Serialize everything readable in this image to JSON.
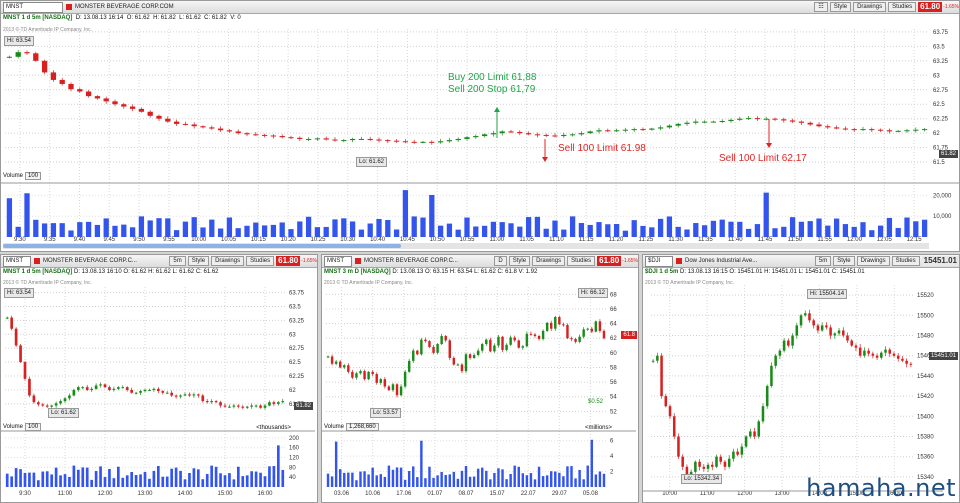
{
  "main": {
    "symbol": "MNST",
    "company": "MONSTER BEVERAGE CORP.COM",
    "style_btn": "Style",
    "drawings_btn": "Drawings",
    "studies_btn": "Studies",
    "price": "61.80",
    "change": "-1.65%",
    "ohlc": {
      "label": "MNST 1 d 5m [NASDAQ]",
      "d": "D: 13.08.13 16:14",
      "o": "O: 61.62",
      "h": "H: 61.82",
      "l": "L: 61.62",
      "c": "C: 61.82",
      "v": "V: 0"
    },
    "copyright": "2013 © TD Ameritrade IP Company, Inc.",
    "hi_label": "Hi: 63.54",
    "lo_label": "Lo: 61.62",
    "current_tag": "61.82",
    "volume_label": "Volume",
    "volume_value": "100",
    "annotations": {
      "buy": "Buy 200 Limit 61,88",
      "sell_stop": "Sell 200 Stop 61,79",
      "sell1": "Sell 100 Limit 61.98",
      "sell2": "Sell 100 Limit 62.17"
    },
    "colors": {
      "up": "#1a8a1a",
      "down": "#d72020",
      "volume": "#3355ee",
      "buy_text": "#1fa648",
      "sell_text": "#e02424"
    }
  },
  "pane2": {
    "symbol": "MNST",
    "company": "MONSTER BEVERAGE CORP.C...",
    "agg": "5m",
    "style_btn": "Style",
    "drawings_btn": "Drawings",
    "studies_btn": "Studies",
    "price": "61.80",
    "change": "-1.65%",
    "ohlc": {
      "label": "MNST 1 d 5m [NASDAQ]",
      "d": "D: 13.08.13 16:10",
      "o": "O: 61.62",
      "h": "H: 61.62",
      "l": "L: 61.62",
      "c": "C: 61.62"
    },
    "copyright": "2013 © TD Ameritrade IP Company, Inc.",
    "hi_label": "Hi: 63.54",
    "lo_label": "Lo: 61.62",
    "current_tag": "61.82",
    "volume_label": "Volume",
    "volume_value": "100",
    "unit": "<thousands>"
  },
  "pane3": {
    "symbol": "MNST",
    "company": "MONSTER BEVERAGE CORP.C...",
    "agg": "D",
    "style_btn": "Style",
    "drawings_btn": "Drawings",
    "studies_btn": "Studies",
    "price": "61.80",
    "change": "-1.65%",
    "ohlc": {
      "label": "MNST 3 m D [NASDAQ]",
      "d": "D: 13.08.13",
      "o": "O: 63.15",
      "h": "H: 63.54",
      "l": "L: 61.62",
      "c": "C: 61.8",
      "v": "V: 1.92"
    },
    "copyright": "2013 © TD Ameritrade IP Company, Inc.",
    "hi_label": "Hi: 66.12",
    "lo_label": "Lo: 53.57",
    "current_tag": "61.8",
    "div_label": "$0.52",
    "volume_label": "Volume",
    "volume_value": "1,268,660",
    "unit": "<millions>"
  },
  "pane4": {
    "symbol": "$DJI",
    "company": "Dow Jones Industrial Ave...",
    "agg": "5m",
    "style_btn": "Style",
    "drawings_btn": "Drawings",
    "studies_btn": "Studies",
    "price": "15451.01",
    "ohlc": {
      "label": "$DJI 1 d 5m",
      "d": "D: 13.08.13 16:15",
      "o": "O: 15451.01",
      "h": "H: 15451.01",
      "l": "L: 15451.01",
      "c": "C: 15451.01"
    },
    "copyright": "2013 © TD Ameritrade IP Company, Inc.",
    "hi_label": "Hi: 15504.14",
    "lo_label": "Lo: 15342.34",
    "current_tag": "15451.01"
  },
  "watermark": "hamaha.net",
  "chart_data": [
    {
      "type": "candlestick",
      "title": "MNST 1 d 5m [NASDAQ]",
      "y_ticks": [
        61.5,
        61.75,
        62,
        62.25,
        62.5,
        62.75,
        63,
        63.25,
        63.5,
        63.75
      ],
      "ylim": [
        61.45,
        63.8
      ],
      "x_ticks": [
        "9:30",
        "9:35",
        "9:40",
        "9:45",
        "9:50",
        "9:55",
        "10:00",
        "10:05",
        "10:15",
        "10:20",
        "10:25",
        "10:30",
        "10:40",
        "10:45",
        "10:50",
        "10:55",
        "11:00",
        "11:05",
        "11:10",
        "11:15",
        "11:20",
        "11:25",
        "11:30",
        "11:35",
        "11:40",
        "11:45",
        "11:50",
        "11:55",
        "12:00",
        "12:05",
        "12:15"
      ],
      "close_series": [
        63.32,
        63.4,
        63.38,
        63.25,
        63.05,
        62.92,
        62.85,
        62.76,
        62.72,
        62.64,
        62.6,
        62.55,
        62.5,
        62.46,
        62.42,
        62.37,
        62.3,
        62.25,
        62.2,
        62.16,
        62.15,
        62.12,
        62.1,
        62.08,
        62.05,
        62.03,
        62.0,
        61.98,
        61.97,
        61.96,
        61.95,
        61.93,
        61.92,
        61.9,
        61.9,
        61.91,
        61.89,
        61.88,
        61.88,
        61.9,
        61.9,
        61.89,
        61.88,
        61.87,
        61.86,
        61.85,
        61.84,
        61.85,
        61.84,
        61.86,
        61.88,
        61.9,
        61.93,
        61.95,
        61.98,
        62.0,
        62.03,
        62.02,
        62.0,
        61.98,
        61.97,
        61.96,
        61.95,
        61.97,
        61.98,
        62.0,
        62.03,
        62.05,
        62.04,
        62.05,
        62.06,
        62.07,
        62.06,
        62.08,
        62.1,
        62.13,
        62.16,
        62.18,
        62.2,
        62.2,
        62.2,
        62.21,
        62.23,
        62.25,
        62.26,
        62.25,
        62.25,
        62.24,
        62.22,
        62.2,
        62.18,
        62.15,
        62.12,
        62.1,
        62.08,
        62.07,
        62.06,
        62.07,
        62.06,
        62.05,
        62.03,
        62.04,
        62.05,
        62.06,
        62.07
      ],
      "volume_ticks": [
        "10,000",
        "20,000"
      ]
    },
    {
      "type": "candlestick",
      "title": "MNST 1 d 5m [NASDAQ]",
      "y_ticks": [
        61.75,
        62,
        62.25,
        62.5,
        62.75,
        63,
        63.25,
        63.5,
        63.75
      ],
      "ylim": [
        61.55,
        63.85
      ],
      "x_ticks": [
        "9:30",
        "11:00",
        "12:00",
        "13:00",
        "14:00",
        "15:00",
        "16:00"
      ],
      "close_series": [
        63.3,
        63.1,
        62.8,
        62.5,
        62.2,
        61.9,
        61.78,
        61.74,
        61.72,
        61.7,
        61.72,
        61.76,
        61.8,
        61.85,
        61.9,
        62.0,
        62.05,
        62.05,
        62.0,
        62.02,
        62.08,
        62.1,
        62.05,
        62.0,
        62.02,
        62.05,
        62.05,
        62.0,
        61.95,
        61.95,
        61.98,
        62.0,
        62.0,
        62.02,
        61.98,
        61.95,
        61.95,
        61.9,
        61.88,
        61.9,
        61.92,
        61.9,
        61.92,
        61.9,
        61.8,
        61.78,
        61.8,
        61.78,
        61.72,
        61.7,
        61.7,
        61.72,
        61.7,
        61.68,
        61.7,
        61.72,
        61.72,
        61.68,
        61.72,
        61.78,
        61.75,
        61.78,
        61.8
      ],
      "volume_ticks": [
        "40",
        "80",
        "120",
        "160",
        "200"
      ]
    },
    {
      "type": "candlestick",
      "title": "MNST 3 m D [NASDAQ]",
      "y_ticks": [
        52,
        54,
        56,
        58,
        60,
        62,
        64,
        66,
        68
      ],
      "ylim": [
        51.5,
        69
      ],
      "x_ticks": [
        "03.06",
        "10.06",
        "17.06",
        "01.07",
        "08.07",
        "15.07",
        "22.07",
        "29.07",
        "05.08"
      ],
      "close_series": [
        59.5,
        58.5,
        58.8,
        58.0,
        58.3,
        57.4,
        56.6,
        57.2,
        57.5,
        56.4,
        57.4,
        57.1,
        55.9,
        56.4,
        55.4,
        54.9,
        55.7,
        54.2,
        55.4,
        57.4,
        58.9,
        60.3,
        59.8,
        61.8,
        61.6,
        60.8,
        60.0,
        61.2,
        62.3,
        61.7,
        59.3,
        58.4,
        58.4,
        57.5,
        59.8,
        59.3,
        59.7,
        60.3,
        61.2,
        61.8,
        60.2,
        61.0,
        62.2,
        60.4,
        61.1,
        62.1,
        61.7,
        60.7,
        60.9,
        62.6,
        62.5,
        62.3,
        61.9,
        63.0,
        64.1,
        63.3,
        64.9,
        63.9,
        63.8,
        62.0,
        61.9,
        61.5,
        62.2,
        63.2,
        63.3,
        62.9,
        64.3,
        63.0,
        62.0
      ],
      "volume_ticks": [
        "2",
        "4",
        "6"
      ]
    },
    {
      "type": "candlestick",
      "title": "$DJI 1 d 5m",
      "y_ticks": [
        15340,
        15360,
        15380,
        15400,
        15420,
        15440,
        15460,
        15480,
        15500,
        15520
      ],
      "ylim": [
        15330,
        15530
      ],
      "x_ticks": [
        "10:00",
        "11:00",
        "12:00",
        "13:00",
        "14:00",
        "15:00",
        "16:00"
      ],
      "close_series": [
        15455,
        15460,
        15420,
        15410,
        15400,
        15380,
        15360,
        15350,
        15342,
        15345,
        15355,
        15350,
        15348,
        15352,
        15350,
        15360,
        15355,
        15350,
        15358,
        15365,
        15362,
        15370,
        15380,
        15385,
        15380,
        15395,
        15410,
        15430,
        15450,
        15460,
        15465,
        15475,
        15470,
        15480,
        15490,
        15500,
        15502,
        15495,
        15490,
        15485,
        15490,
        15488,
        15480,
        15482,
        15485,
        15480,
        15475,
        15470,
        15468,
        15460,
        15465,
        15462,
        15460,
        15458,
        15463,
        15466,
        15462,
        15460,
        15457,
        15455,
        15452,
        15451
      ]
    }
  ]
}
